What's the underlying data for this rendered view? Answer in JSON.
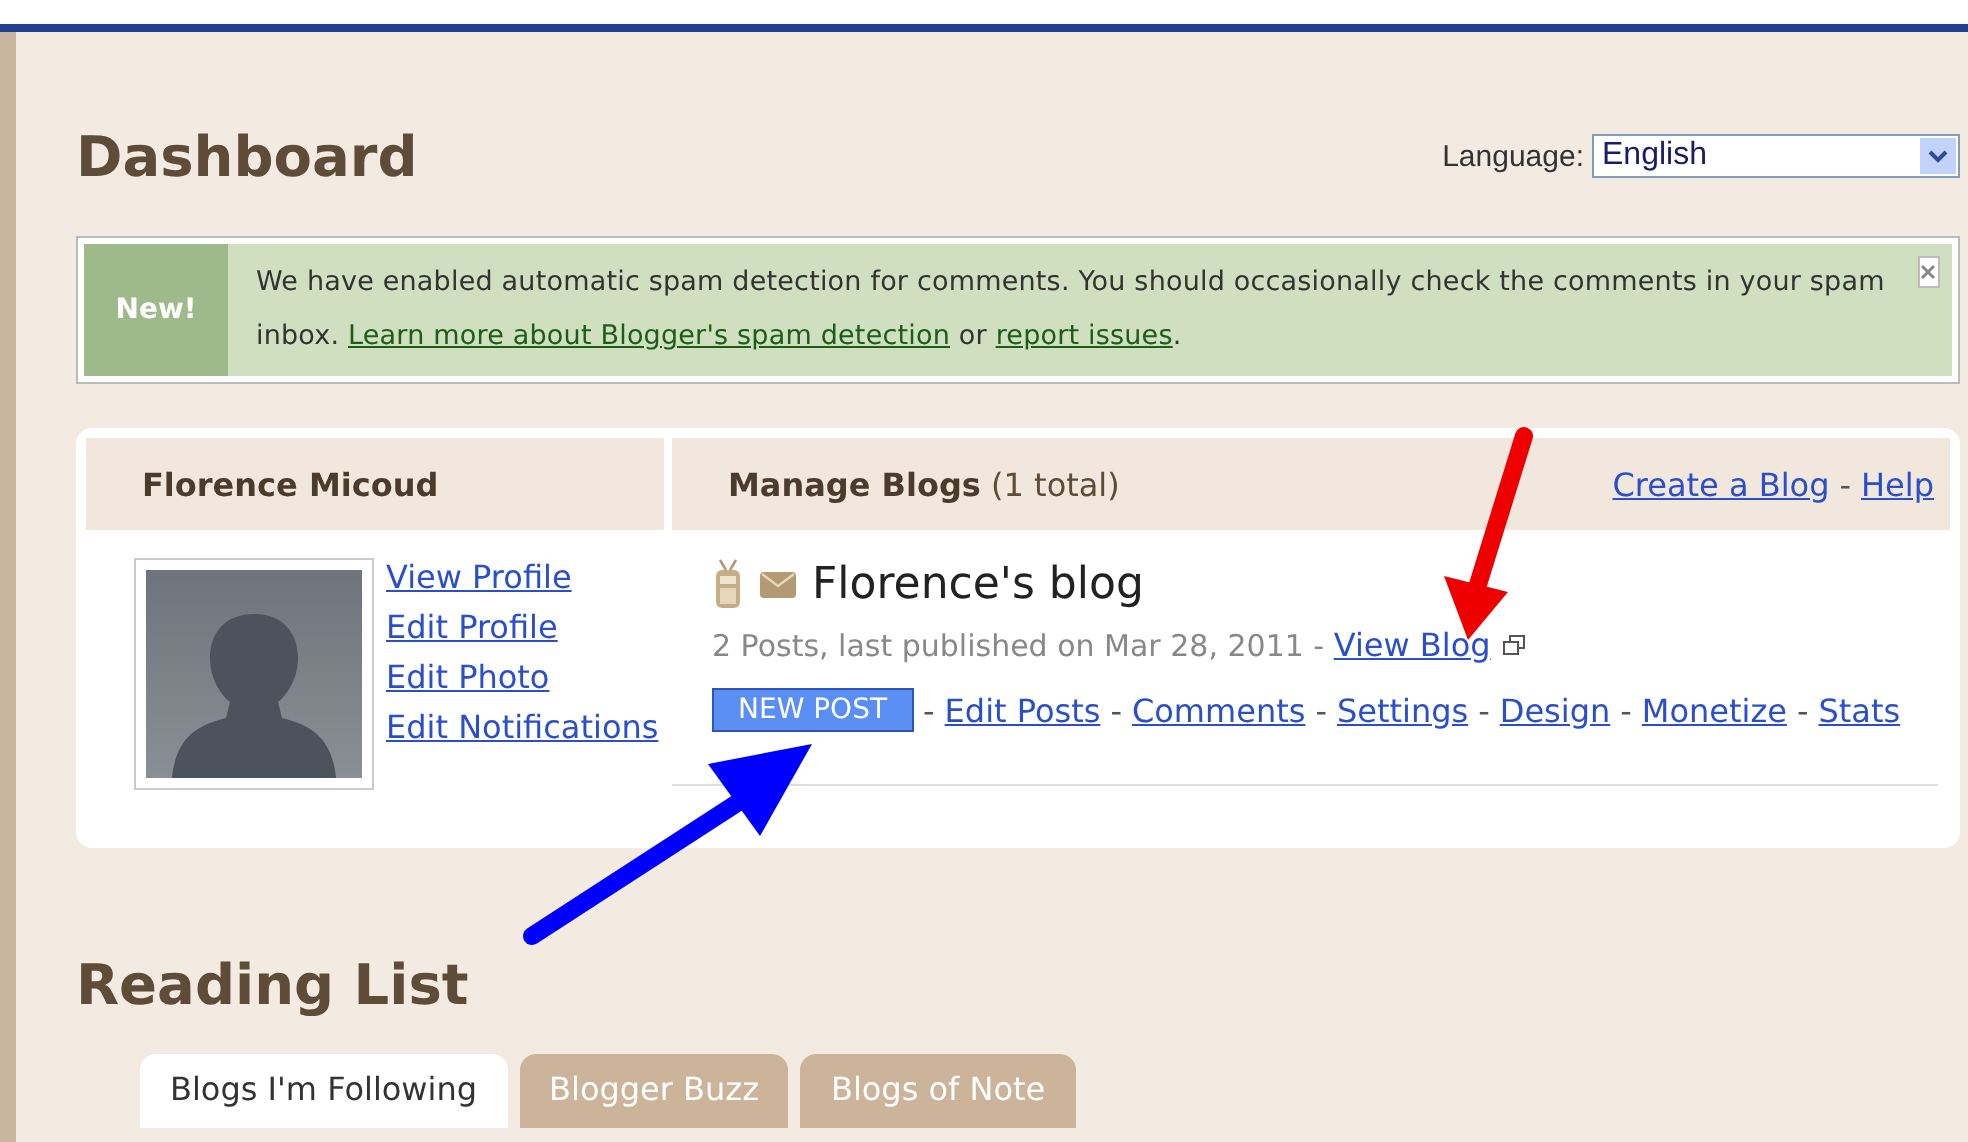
{
  "header": {
    "title": "Dashboard",
    "language": {
      "label": "Language:",
      "value": "English"
    }
  },
  "notice": {
    "badge": "New!",
    "text": "We have enabled automatic spam detection for comments. You should occasionally check the comments in your spam inbox. ",
    "link1": "Learn more about Blogger's spam detection",
    "joiner": " or ",
    "link2": "report issues",
    "end": "."
  },
  "profile": {
    "name": "Florence Micoud",
    "links": [
      "View Profile",
      "Edit Profile",
      "Edit Photo",
      "Edit Notifications"
    ]
  },
  "manage": {
    "title": "Manage Blogs",
    "count": "(1 total)",
    "create": "Create a Blog",
    "separator": "-",
    "help": "Help",
    "blog": {
      "name": "Florence's blog",
      "meta": "2 Posts, last published on Mar 28, 2011 - ",
      "view": "View Blog",
      "new_post": "NEW POST",
      "actions": [
        {
          "separator": "-",
          "label": "Edit Posts"
        },
        {
          "separator": "-",
          "label": "Comments"
        },
        {
          "separator": "-",
          "label": "Settings"
        },
        {
          "separator": "-",
          "label": "Design"
        },
        {
          "separator": "-",
          "label": "Monetize"
        },
        {
          "separator": "-",
          "label": "Stats"
        }
      ]
    }
  },
  "reading": {
    "title": "Reading List",
    "tabs": [
      {
        "label": "Blogs I'm Following",
        "selected": true
      },
      {
        "label": "Blogger Buzz",
        "selected": false
      },
      {
        "label": "Blogs of Note",
        "selected": false
      }
    ]
  }
}
